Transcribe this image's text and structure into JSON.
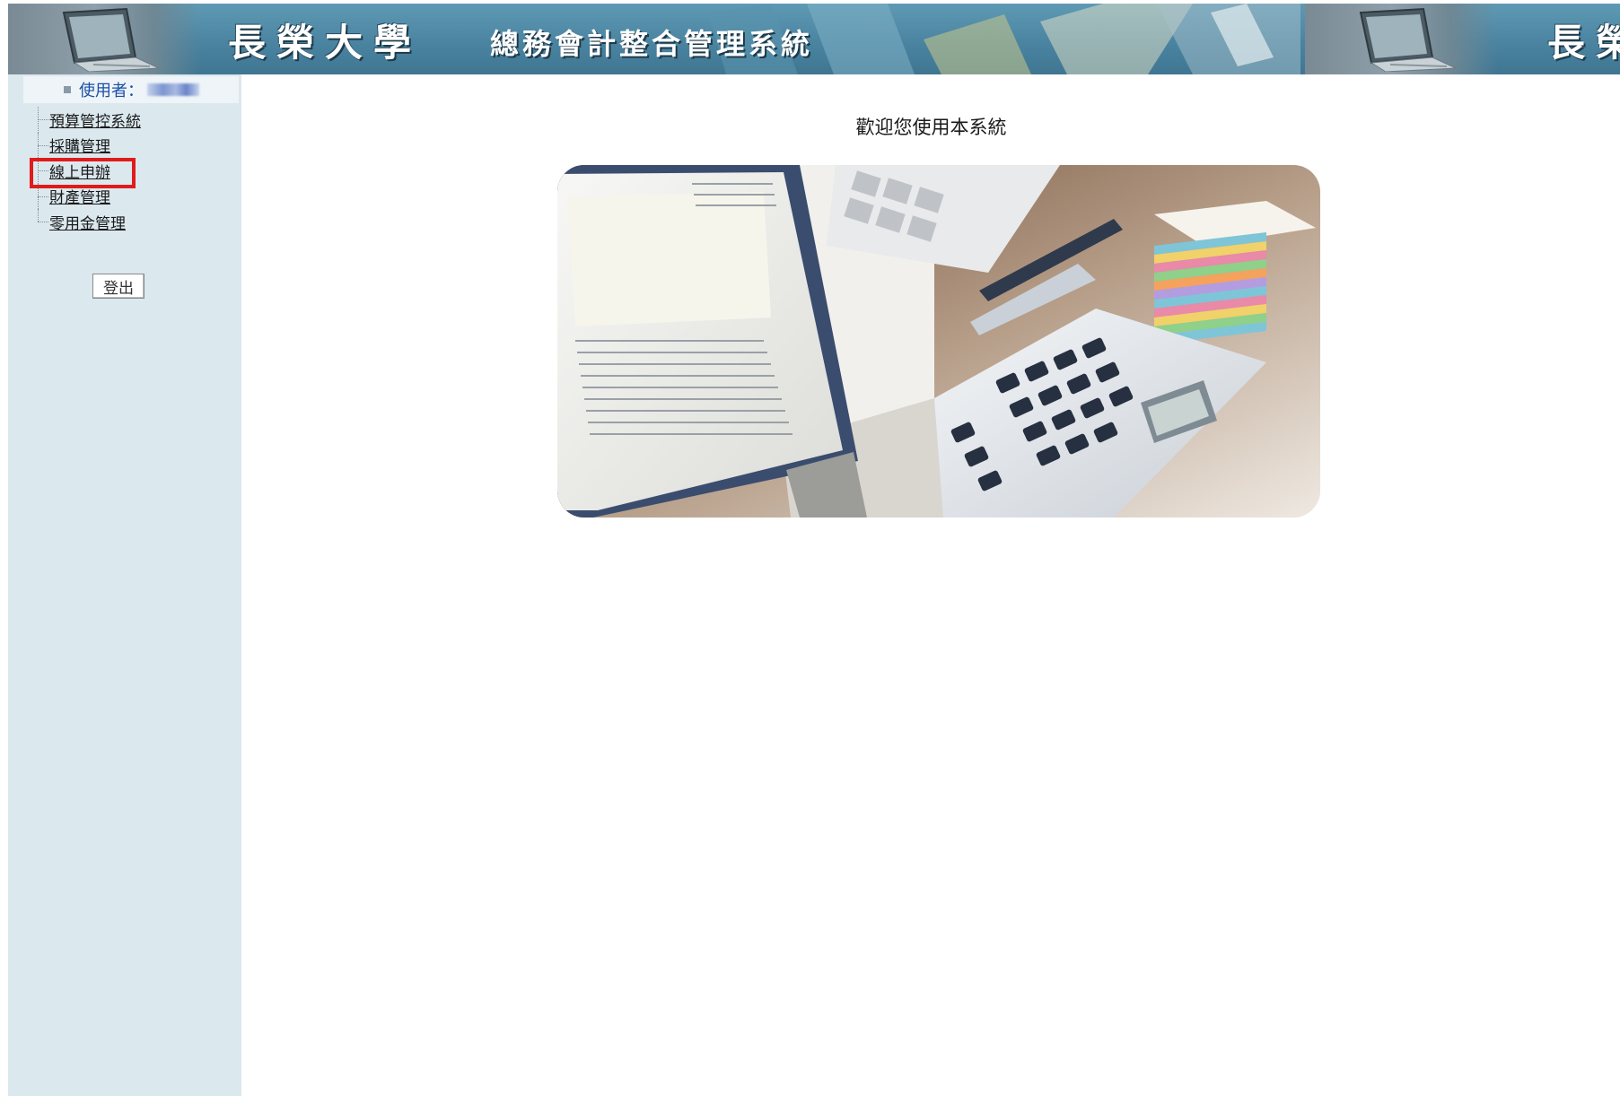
{
  "banner": {
    "school_name": "長榮大學",
    "system_name": "總務會計整合管理系統",
    "school_name_partial": "長榮"
  },
  "sidebar": {
    "user_label": "使用者：",
    "menu": [
      {
        "label": "預算管控系統",
        "highlighted": false
      },
      {
        "label": "採購管理",
        "highlighted": false
      },
      {
        "label": "線上申辦",
        "highlighted": true
      },
      {
        "label": "財產管理",
        "highlighted": false
      },
      {
        "label": "零用金管理",
        "highlighted": false
      }
    ],
    "logout_label": "登出"
  },
  "main": {
    "welcome_text": "歡迎您使用本系統"
  },
  "colors": {
    "banner": "#4a84a1",
    "sidebar": "#dbe8ee",
    "highlight": "#e01b1b",
    "user_label": "#1a4fa8"
  },
  "icons": {
    "banner_left": "laptop-icon",
    "hero": "calculator-documents-photo"
  }
}
